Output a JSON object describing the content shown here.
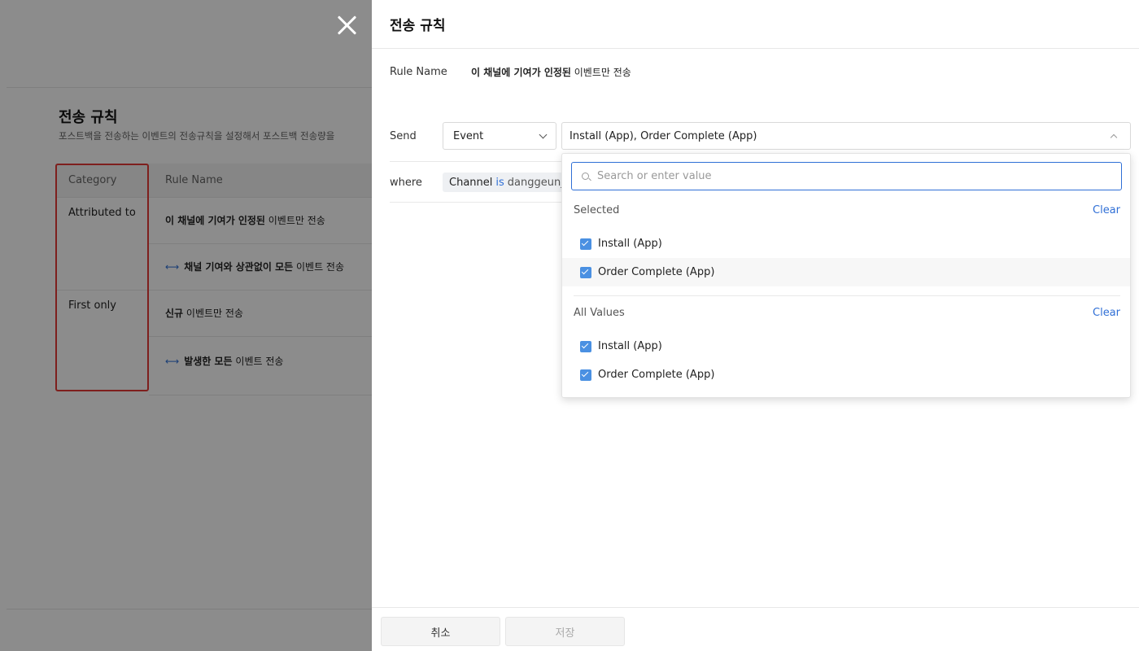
{
  "background": {
    "title": "전송 규칙",
    "description": "포스트백을 전송하는 이벤트의 전송규칙을 설정해서 포스트백 전송량을",
    "table": {
      "headers": [
        "Category",
        "Rule Name"
      ],
      "groups": [
        {
          "category": "Attributed to",
          "rules": [
            {
              "prefix": "",
              "bold": "이 채널에 기여가 인정된",
              "rest": " 이벤트만 전송"
            },
            {
              "prefix": "⟷",
              "bold": "채널 기여와 상관없이 모든",
              "rest": " 이벤트 전송"
            }
          ]
        },
        {
          "category": "First only",
          "rules": [
            {
              "prefix": "",
              "bold": "신규",
              "rest": " 이벤트만 전송"
            },
            {
              "prefix": "⟷",
              "bold": "발생한 모든",
              "rest": " 이벤트 전송"
            }
          ]
        }
      ]
    }
  },
  "drawer": {
    "title": "전송 규칙",
    "rule_name_label": "Rule Name",
    "rule_name_bold": "이 채널에 기여가 인정된",
    "rule_name_rest": " 이벤트만 전송",
    "send_label": "Send",
    "event_select": "Event",
    "values_select": "Install (App), Order Complete (App)",
    "where_label": "where",
    "condition": {
      "field": "Channel",
      "op": "is",
      "value": "danggeun_"
    }
  },
  "dropdown": {
    "search_placeholder": "Search or enter value",
    "selected_title": "Selected",
    "all_title": "All Values",
    "clear_label": "Clear",
    "selected": [
      "Install (App)",
      "Order Complete (App)"
    ],
    "all": [
      "Install (App)",
      "Order Complete (App)"
    ]
  },
  "footer": {
    "cancel": "취소",
    "save": "저장"
  },
  "colors": {
    "accent": "#2f6fd6",
    "checkbox": "#4a90e2",
    "highlight": "#e53935"
  }
}
